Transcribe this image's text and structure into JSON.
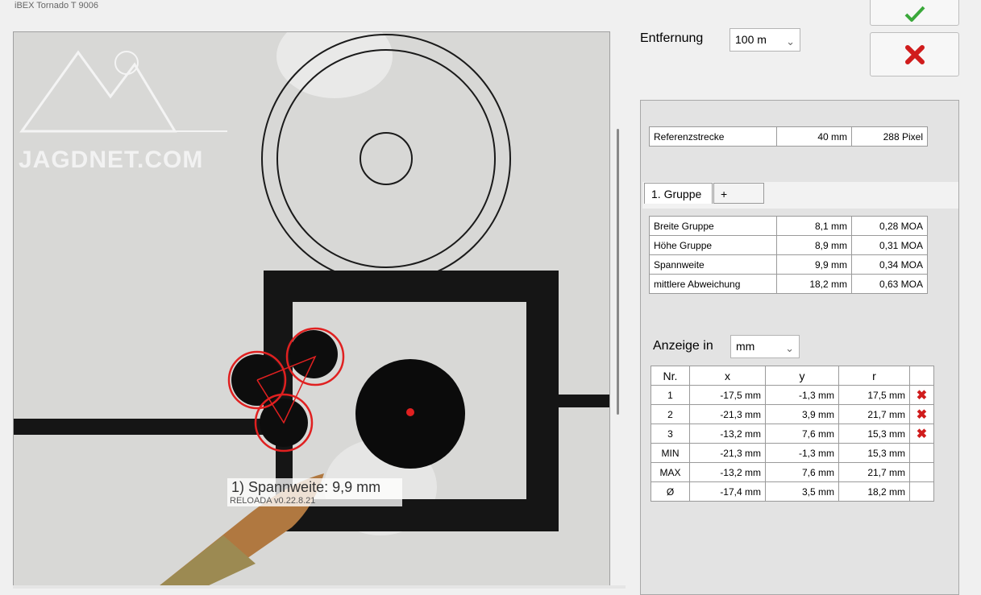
{
  "window": {
    "title": "iBEX Tornado T 9006"
  },
  "image_view": {
    "watermark": "JAGDNET.COM",
    "overlay": {
      "label": "1) Spannweite: 9,9 mm",
      "sub": "RELOADA v0.22.8.21"
    }
  },
  "distance": {
    "label": "Entfernung",
    "value": "100 m"
  },
  "buttons": {
    "ok_icon": "checkmark-icon",
    "cancel_icon": "x-icon"
  },
  "reference": {
    "label": "Referenzstrecke",
    "mm": "40 mm",
    "pixel": "288 Pixel"
  },
  "tabs": [
    {
      "label": "1. Gruppe"
    },
    {
      "label": "+"
    }
  ],
  "stats": [
    {
      "label": "Breite Gruppe",
      "mm": "8,1 mm",
      "moa": "0,28 MOA"
    },
    {
      "label": "Höhe Gruppe",
      "mm": "8,9 mm",
      "moa": "0,31 MOA"
    },
    {
      "label": "Spannweite",
      "mm": "9,9 mm",
      "moa": "0,34 MOA"
    },
    {
      "label": "mittlere Abweichung",
      "mm": "18,2 mm",
      "moa": "0,63 MOA"
    }
  ],
  "display": {
    "label": "Anzeige in",
    "value": "mm"
  },
  "results": {
    "headers": [
      "Nr.",
      "x",
      "y",
      "r"
    ],
    "rows": [
      {
        "nr": "1",
        "x": "-17,5 mm",
        "y": "-1,3 mm",
        "r": "17,5 mm"
      },
      {
        "nr": "2",
        "x": "-21,3 mm",
        "y": "3,9 mm",
        "r": "21,7 mm"
      },
      {
        "nr": "3",
        "x": "-13,2 mm",
        "y": "7,6 mm",
        "r": "15,3 mm"
      },
      {
        "nr": "MIN",
        "x": "-21,3 mm",
        "y": "-1,3 mm",
        "r": "15,3 mm"
      },
      {
        "nr": "MAX",
        "x": "-13,2 mm",
        "y": "7,6 mm",
        "r": "21,7 mm"
      },
      {
        "nr": "Ø",
        "x": "-17,4 mm",
        "y": "3,5 mm",
        "r": "18,2 mm"
      }
    ]
  },
  "colors": {
    "accent_red": "#d01c1c",
    "check_green": "#3aa83a",
    "marker_red": "#e02020"
  }
}
